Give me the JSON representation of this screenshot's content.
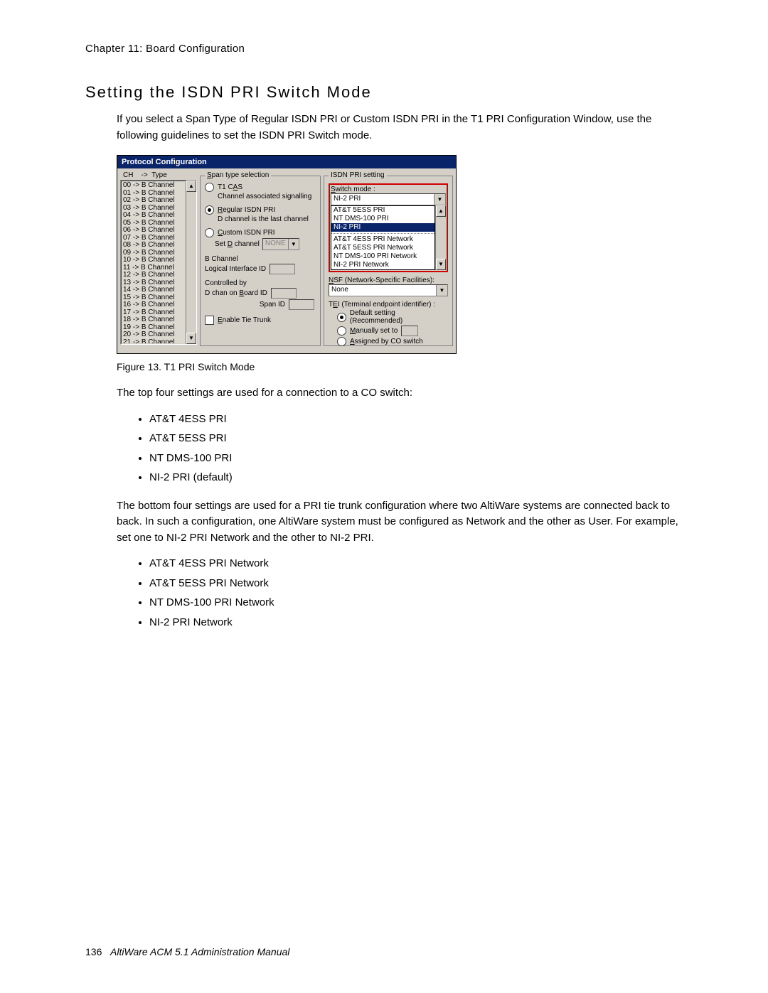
{
  "header": {
    "chapter_line": "Chapter 11:  Board Configuration"
  },
  "section": {
    "title": "Setting the ISDN PRI Switch Mode",
    "intro": "If you select a Span Type of Regular ISDN PRI or Custom ISDN PRI in the T1 PRI Configuration Window, use the following guidelines to set the ISDN PRI Switch mode."
  },
  "figure": {
    "caption": "Figure 13.   T1 PRI Switch Mode"
  },
  "para1": "The top four settings are used for a connection to a CO switch:",
  "list1": [
    "AT&T 4ESS PRI",
    "AT&T 5ESS PRI",
    "NT DMS-100 PRI",
    "NI-2 PRI (default)"
  ],
  "para2": "The bottom four settings are used for a PRI tie trunk configuration where two AltiWare systems are connected back to back. In such a configuration, one AltiWare system must be configured as Network and the other as User. For example, set one to NI-2 PRI Network and the other to NI-2 PRI.",
  "list2": [
    "AT&T 4ESS PRI Network",
    "AT&T 5ESS PRI Network",
    "NT DMS-100 PRI Network",
    "NI-2 PRI Network"
  ],
  "footer": {
    "page_num": "136",
    "manual": "AltiWare ACM 5.1 Administration Manual"
  },
  "dialog": {
    "title": "Protocol Configuration",
    "ch_header": "CH    ->  Type",
    "channels": [
      "00 -> B Channel",
      "01 -> B Channel",
      "02 -> B Channel",
      "03 -> B Channel",
      "04 -> B Channel",
      "05 -> B Channel",
      "06 -> B Channel",
      "07 -> B Channel",
      "08 -> B Channel",
      "09 -> B Channel",
      "10 -> B Channel",
      "11 -> B Channel",
      "12 -> B Channel",
      "13 -> B Channel",
      "14 -> B Channel",
      "15 -> B Channel",
      "16 -> B Channel",
      "17 -> B Channel",
      "18 -> B Channel",
      "19 -> B Channel",
      "20 -> B Channel",
      "21 -> B Channel"
    ],
    "span_group": {
      "legend": "Span type selection",
      "t1cas_label": "T1 CAS",
      "t1cas_sub": "Channel associated signalling",
      "reg_label": "Regular ISDN PRI",
      "reg_sub": "D channel is the last channel",
      "cus_label": "Custom ISDN PRI",
      "setd_label": "Set D channel",
      "setd_value": "NONE",
      "bchan_label": "B Channel",
      "logical_label": "Logical Interface ID",
      "ctrl_label": "Controlled by",
      "dchan_label": "D chan on Board ID",
      "spanid_label": "Span ID",
      "tietrunk_label": "Enable Tie Trunk"
    },
    "isdn_group": {
      "legend": "ISDN PRI setting",
      "switch_label": "Switch mode :",
      "switch_value": "NI-2 PRI",
      "options_top": [
        "AT&T 5ESS PRI",
        "NT DMS-100 PRI",
        "NI-2 PRI"
      ],
      "options_bottom": [
        "AT&T 4ESS PRI Network",
        "AT&T 5ESS PRI Network",
        "NT DMS-100 PRI Network",
        "NI-2 PRI Network"
      ],
      "nsf_label": "NSF (Network-Specific Facilities):",
      "nsf_value": "None",
      "tei_label": "TEI (Terminal endpoint identifier) :",
      "tei_default": "Default setting (Recommended)",
      "tei_manual": "Manually set to",
      "tei_assigned": "Assigned by CO switch"
    }
  }
}
